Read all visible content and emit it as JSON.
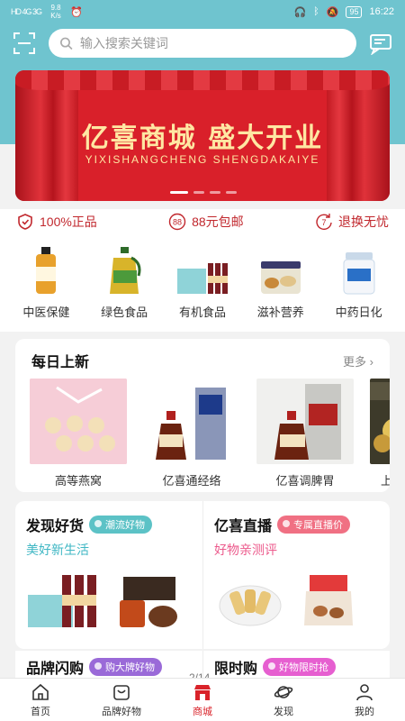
{
  "status_bar": {
    "left": "HD 4G 3G",
    "speed": "9.8 K/s",
    "battery": "95",
    "time": "16:22"
  },
  "search": {
    "placeholder": "输入搜索关键词"
  },
  "banner": {
    "title": "亿喜商城 盛大开业",
    "subtitle": "YIXISHANGCHENG SHENGDAKAIYE"
  },
  "guarantees": [
    {
      "label": "100%正品",
      "icon": "shield-icon"
    },
    {
      "label": "88元包邮",
      "icon": "badge-88-icon"
    },
    {
      "label": "退换无忧",
      "icon": "return-7-icon"
    }
  ],
  "categories": [
    {
      "label": "中医保健"
    },
    {
      "label": "绿色食品"
    },
    {
      "label": "有机食品"
    },
    {
      "label": "滋补营养"
    },
    {
      "label": "中药日化"
    }
  ],
  "daily_new": {
    "title": "每日上新",
    "more": "更多",
    "items": [
      {
        "label": "高等燕窝"
      },
      {
        "label": "亿喜通经络"
      },
      {
        "label": "亿喜调脾胃"
      },
      {
        "label": "上李"
      }
    ]
  },
  "discover": {
    "title": "发现好货",
    "tag": "潮流好物",
    "subtitle": "美好新生活"
  },
  "live": {
    "title": "亿喜直播",
    "tag": "专属直播价",
    "subtitle": "好物亲测评"
  },
  "brand_flash": {
    "title": "品牌闪购",
    "tag": "购大牌好物"
  },
  "limited": {
    "title": "限时购",
    "tag": "好物限时抢"
  },
  "pager": "2/14",
  "nav": [
    {
      "label": "首页",
      "icon": "home-icon"
    },
    {
      "label": "品牌好物",
      "icon": "bag-icon"
    },
    {
      "label": "商城",
      "icon": "store-icon"
    },
    {
      "label": "发现",
      "icon": "planet-icon"
    },
    {
      "label": "我的",
      "icon": "user-icon"
    }
  ],
  "colors": {
    "header": "#6fc4cf",
    "accent_red": "#d9232a",
    "banner_text": "#ffe7a3"
  }
}
